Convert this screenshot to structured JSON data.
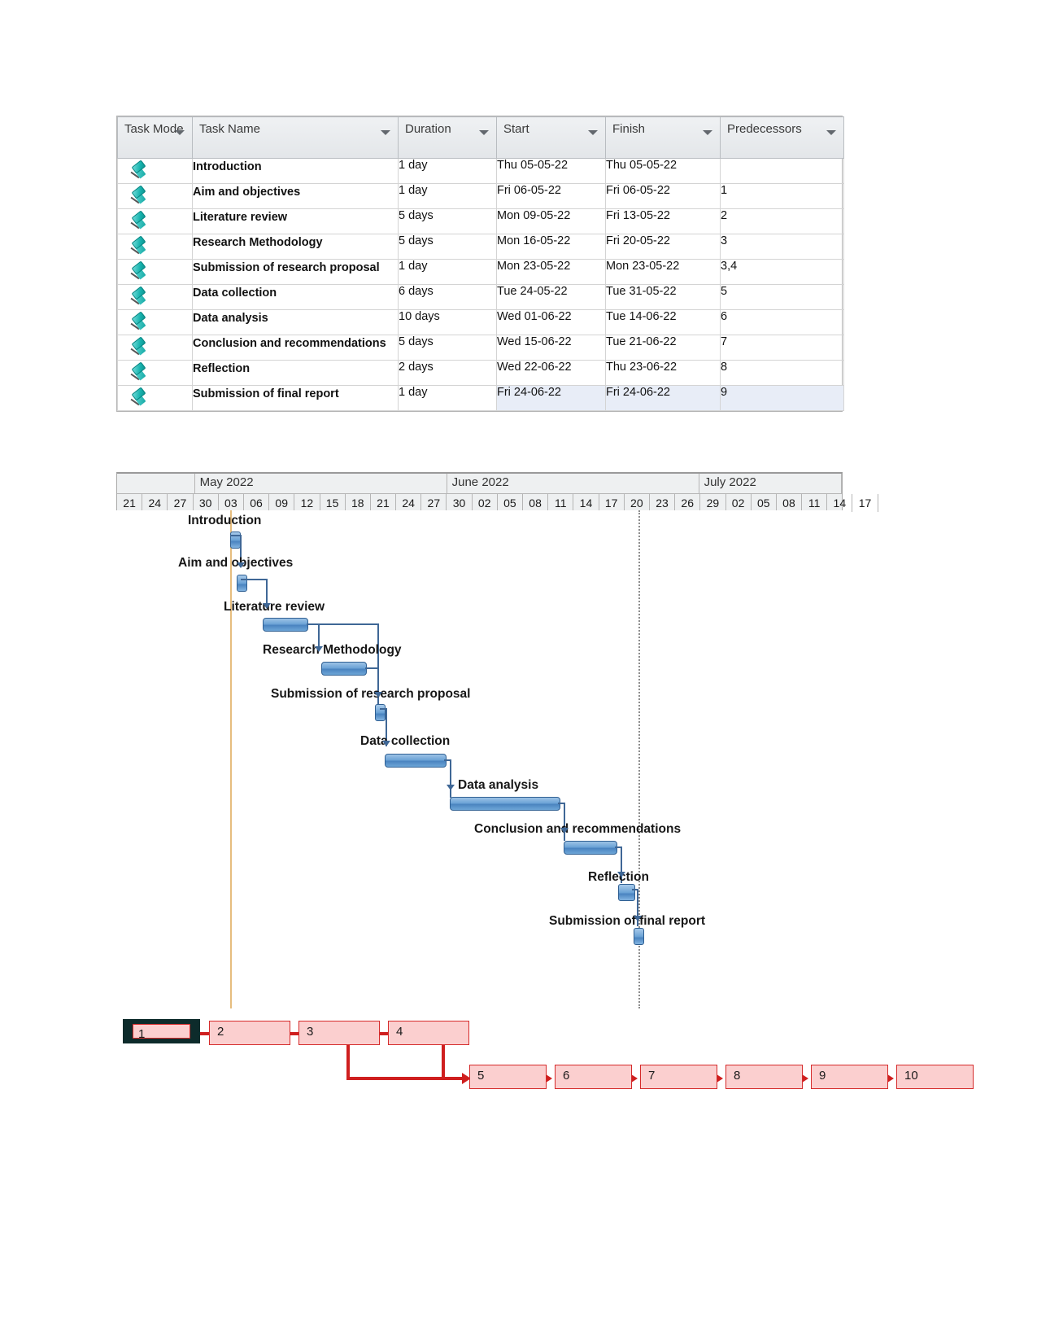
{
  "table": {
    "columns": [
      {
        "key": "task_mode",
        "label": "Task Mode"
      },
      {
        "key": "task_name",
        "label": "Task Name"
      },
      {
        "key": "duration",
        "label": "Duration"
      },
      {
        "key": "start",
        "label": "Start"
      },
      {
        "key": "finish",
        "label": "Finish"
      },
      {
        "key": "predecessors",
        "label": "Predecessors"
      }
    ],
    "header_highlight_color": "#ffd24a",
    "mode_icon": "pushpin-icon",
    "rows": [
      {
        "id": 1,
        "mode": "manually-scheduled",
        "name": "Introduction",
        "duration": "1 day",
        "start": "Thu 05-05-22",
        "finish": "Thu 05-05-22",
        "predecessors": ""
      },
      {
        "id": 2,
        "mode": "manually-scheduled",
        "name": "Aim and objectives",
        "duration": "1 day",
        "start": "Fri 06-05-22",
        "finish": "Fri 06-05-22",
        "predecessors": "1"
      },
      {
        "id": 3,
        "mode": "manually-scheduled",
        "name": "Literature review",
        "duration": "5 days",
        "start": "Mon 09-05-22",
        "finish": "Fri 13-05-22",
        "predecessors": "2"
      },
      {
        "id": 4,
        "mode": "manually-scheduled",
        "name": "Research Methodology",
        "duration": "5 days",
        "start": "Mon 16-05-22",
        "finish": "Fri 20-05-22",
        "predecessors": "3"
      },
      {
        "id": 5,
        "mode": "manually-scheduled",
        "name": "Submission of research proposal",
        "duration": "1 day",
        "start": "Mon 23-05-22",
        "finish": "Mon 23-05-22",
        "predecessors": "3,4"
      },
      {
        "id": 6,
        "mode": "manually-scheduled",
        "name": "Data collection",
        "duration": "6 days",
        "start": "Tue 24-05-22",
        "finish": "Tue 31-05-22",
        "predecessors": "5"
      },
      {
        "id": 7,
        "mode": "manually-scheduled",
        "name": "Data analysis",
        "duration": "10 days",
        "start": "Wed 01-06-22",
        "finish": "Tue 14-06-22",
        "predecessors": "6"
      },
      {
        "id": 8,
        "mode": "manually-scheduled",
        "name": "Conclusion and recommendations",
        "duration": "5 days",
        "start": "Wed 15-06-22",
        "finish": "Tue 21-06-22",
        "predecessors": "7"
      },
      {
        "id": 9,
        "mode": "manually-scheduled",
        "name": "Reflection",
        "duration": "2 days",
        "start": "Wed 22-06-22",
        "finish": "Thu 23-06-22",
        "predecessors": "8"
      },
      {
        "id": 10,
        "mode": "manually-scheduled",
        "name": "Submission of final report",
        "duration": "1 day",
        "start": "Fri 24-06-22",
        "finish": "Fri 24-06-22",
        "predecessors": "9",
        "selected": true
      }
    ]
  },
  "timeline": {
    "months": [
      "May 2022",
      "June 2022",
      "July 2022"
    ],
    "days": [
      "21",
      "24",
      "27",
      "30",
      "03",
      "06",
      "09",
      "12",
      "15",
      "18",
      "21",
      "24",
      "27",
      "30",
      "02",
      "05",
      "08",
      "11",
      "14",
      "17",
      "20",
      "23",
      "26",
      "29",
      "02",
      "05",
      "08",
      "11",
      "14",
      "17"
    ]
  },
  "chart_data": {
    "type": "gantt",
    "title": "Research project schedule",
    "timeline_start": "2022-04-21",
    "timeline_end": "2022-07-17",
    "tick_interval_days": 3,
    "months": [
      "May 2022",
      "June 2022",
      "July 2022"
    ],
    "tick_labels": [
      "21",
      "24",
      "27",
      "30",
      "03",
      "06",
      "09",
      "12",
      "15",
      "18",
      "21",
      "24",
      "27",
      "30",
      "02",
      "05",
      "08",
      "11",
      "14",
      "17",
      "20",
      "23",
      "26",
      "29",
      "02",
      "05",
      "08",
      "11",
      "14",
      "17"
    ],
    "tasks": [
      {
        "id": 1,
        "name": "Introduction",
        "start": "2022-05-05",
        "finish": "2022-05-05",
        "duration_days": 1,
        "milestone_like": true,
        "predecessors": []
      },
      {
        "id": 2,
        "name": "Aim and objectives",
        "start": "2022-05-06",
        "finish": "2022-05-06",
        "duration_days": 1,
        "milestone_like": true,
        "predecessors": [
          1
        ]
      },
      {
        "id": 3,
        "name": "Literature review",
        "start": "2022-05-09",
        "finish": "2022-05-13",
        "duration_days": 5,
        "milestone_like": false,
        "predecessors": [
          2
        ]
      },
      {
        "id": 4,
        "name": "Research Methodology",
        "start": "2022-05-16",
        "finish": "2022-05-20",
        "duration_days": 5,
        "milestone_like": false,
        "predecessors": [
          3
        ]
      },
      {
        "id": 5,
        "name": "Submission of research proposal",
        "start": "2022-05-23",
        "finish": "2022-05-23",
        "duration_days": 1,
        "milestone_like": true,
        "predecessors": [
          3,
          4
        ]
      },
      {
        "id": 6,
        "name": "Data collection",
        "start": "2022-05-24",
        "finish": "2022-05-31",
        "duration_days": 6,
        "milestone_like": false,
        "predecessors": [
          5
        ]
      },
      {
        "id": 7,
        "name": "Data analysis",
        "start": "2022-06-01",
        "finish": "2022-06-14",
        "duration_days": 10,
        "milestone_like": false,
        "predecessors": [
          6
        ]
      },
      {
        "id": 8,
        "name": "Conclusion and recommendations",
        "start": "2022-06-15",
        "finish": "2022-06-21",
        "duration_days": 5,
        "milestone_like": false,
        "predecessors": [
          7
        ]
      },
      {
        "id": 9,
        "name": "Reflection",
        "start": "2022-06-22",
        "finish": "2022-06-23",
        "duration_days": 2,
        "milestone_like": true,
        "predecessors": [
          8
        ]
      },
      {
        "id": 10,
        "name": "Submission of final report",
        "start": "2022-06-24",
        "finish": "2022-06-24",
        "duration_days": 1,
        "milestone_like": true,
        "predecessors": [
          9
        ]
      }
    ],
    "bar_color": "#5b93cc",
    "bar_border_color": "#2f5f92",
    "link_color": "#3f6796",
    "today_line_color": "#e6bd7e",
    "status_line_color": "#8d8d8d"
  },
  "gantt_labels": [
    "Introduction",
    "Aim and objectives",
    "Literature review",
    "Research Methodology",
    "Submission of research proposal",
    "Data collection",
    "Data analysis",
    "Conclusion and recommendations",
    "Reflection",
    "Submission of final report"
  ],
  "network": {
    "node_fill": "#fbcfcf",
    "node_border": "#d52b2b",
    "link_color": "#cf1f1f",
    "selected_node": "1",
    "nodes": [
      {
        "label": "1",
        "row": 1
      },
      {
        "label": "2",
        "row": 1
      },
      {
        "label": "3",
        "row": 1
      },
      {
        "label": "4",
        "row": 1
      },
      {
        "label": "5",
        "row": 2
      },
      {
        "label": "6",
        "row": 2
      },
      {
        "label": "7",
        "row": 2
      },
      {
        "label": "8",
        "row": 2
      },
      {
        "label": "9",
        "row": 2
      },
      {
        "label": "10",
        "row": 2
      }
    ]
  }
}
